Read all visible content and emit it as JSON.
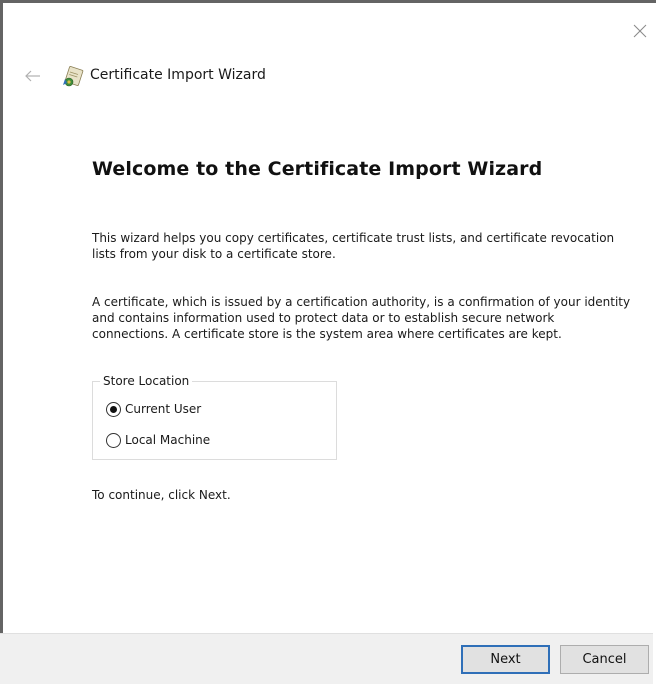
{
  "window": {
    "title": "Certificate Import Wizard"
  },
  "page": {
    "heading": "Welcome to the Certificate Import Wizard",
    "intro": "This wizard helps you copy certificates, certificate trust lists, and certificate revocation lists from your disk to a certificate store.",
    "description": "A certificate, which is issued by a certification authority, is a confirmation of your identity and contains information used to protect data or to establish secure network connections. A certificate store is the system area where certificates are kept.",
    "continue_hint": "To continue, click Next."
  },
  "store_location": {
    "label": "Store Location",
    "options": [
      {
        "label": "Current User",
        "checked": true
      },
      {
        "label": "Local Machine",
        "checked": false
      }
    ]
  },
  "footer": {
    "next_label": "Next",
    "cancel_label": "Cancel"
  },
  "icons": {
    "close": "close-icon",
    "back": "back-arrow-icon",
    "wizard": "certificate-icon"
  },
  "colors": {
    "default_button_border": "#2f6fb8",
    "footer_background": "#f0f0f0"
  }
}
